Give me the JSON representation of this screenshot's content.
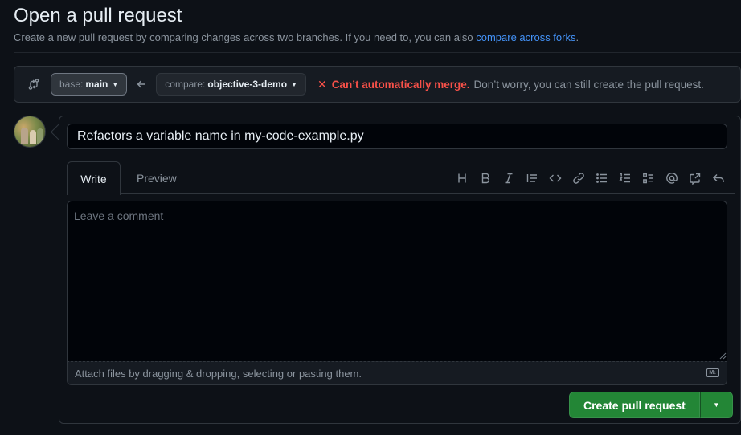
{
  "header": {
    "title": "Open a pull request",
    "subtitle": "Create a new pull request by comparing changes across two branches. If you need to, you can also ",
    "forks_link": "compare across forks",
    "subtitle_end": "."
  },
  "compare": {
    "base_key": "base:",
    "base_value": "main",
    "compare_key": "compare:",
    "compare_value": "objective-3-demo",
    "merge_error": "Can’t automatically merge.",
    "merge_note": "Don’t worry, you can still create the pull request."
  },
  "form": {
    "title_value": "Refactors a variable name in my-code-example.py",
    "tabs": [
      "Write",
      "Preview"
    ],
    "comment_placeholder": "Leave a comment",
    "attach_text": "Attach files by dragging & dropping, selecting or pasting them.",
    "markdown_badge": "M↓",
    "toolbar_icons": [
      "heading-icon",
      "bold-icon",
      "italic-icon",
      "quote-icon",
      "code-icon",
      "link-icon",
      "unordered-list-icon",
      "ordered-list-icon",
      "task-list-icon",
      "mention-icon",
      "reference-icon",
      "reply-icon"
    ]
  },
  "actions": {
    "create_label": "Create pull request"
  },
  "colors": {
    "background": "#0d1117",
    "accent_link": "#4493f8",
    "error": "#f85149",
    "primary_button": "#238636"
  }
}
